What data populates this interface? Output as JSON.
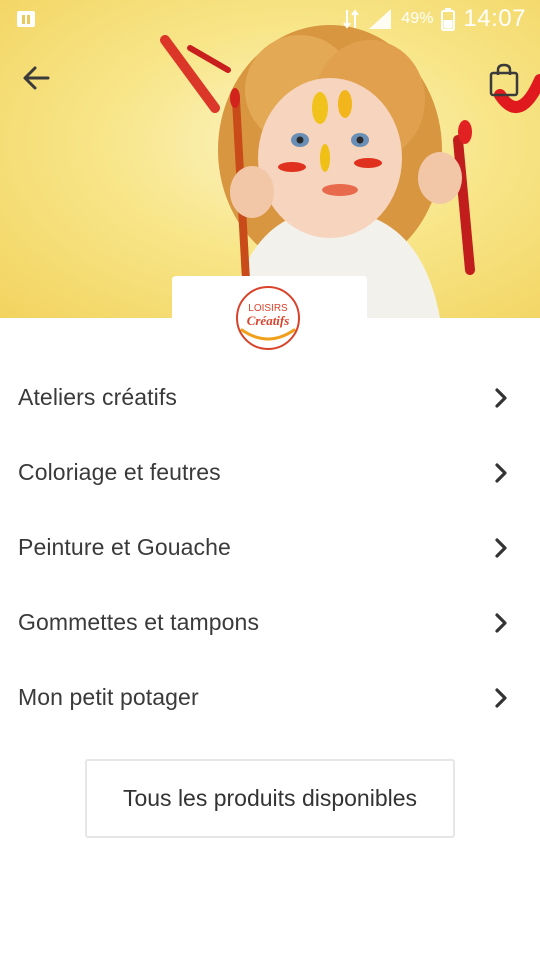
{
  "status_bar": {
    "battery": "49%",
    "time": "14:07"
  },
  "header": {
    "back_icon": "arrow-left-icon",
    "cart_icon": "shopping-bag-icon"
  },
  "logo": {
    "line1": "LOISIRS",
    "line2": "Créatifs"
  },
  "menu": {
    "items": [
      {
        "label": "Ateliers créatifs",
        "icon": "chevron-right-icon"
      },
      {
        "label": "Coloriage et feutres",
        "icon": "chevron-right-icon"
      },
      {
        "label": "Peinture et Gouache",
        "icon": "chevron-right-icon"
      },
      {
        "label": "Gommettes et tampons",
        "icon": "chevron-right-icon"
      },
      {
        "label": "Mon petit potager",
        "icon": "chevron-right-icon"
      }
    ]
  },
  "all_products_button": {
    "label": "Tous les produits disponibles"
  },
  "colors": {
    "text": "#333333",
    "border": "#e6e6e6",
    "logo_red": "#d9432b",
    "hero_yellow": "#f6df7a"
  }
}
